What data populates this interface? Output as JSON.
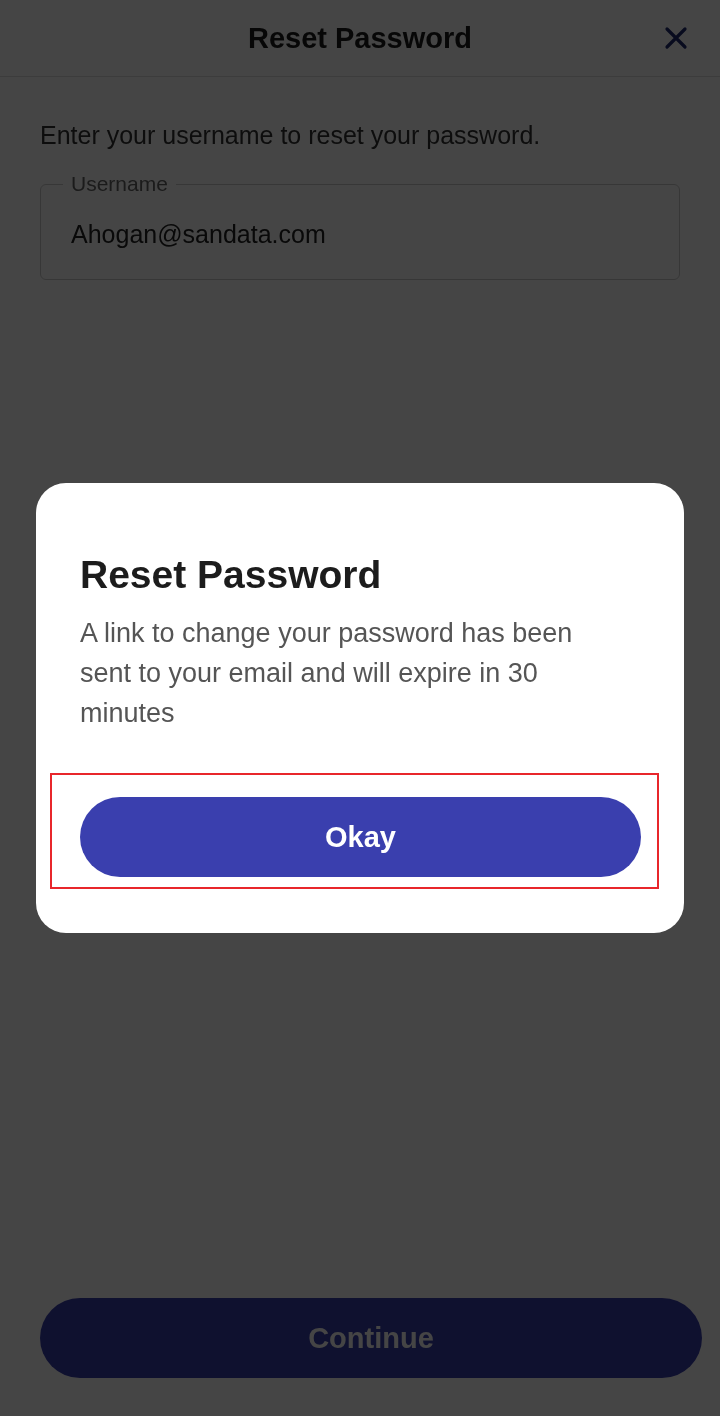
{
  "header": {
    "title": "Reset Password"
  },
  "instruction": "Enter your username to reset your password.",
  "username_field": {
    "label": "Username",
    "value": "Ahogan@sandata.com"
  },
  "continue_button": {
    "label": "Continue"
  },
  "dialog": {
    "title": "Reset Password",
    "message": "A link to change your password has been sent to your email and will expire in 30 minutes",
    "button": {
      "label": "Okay",
      "highlighted": true
    }
  }
}
